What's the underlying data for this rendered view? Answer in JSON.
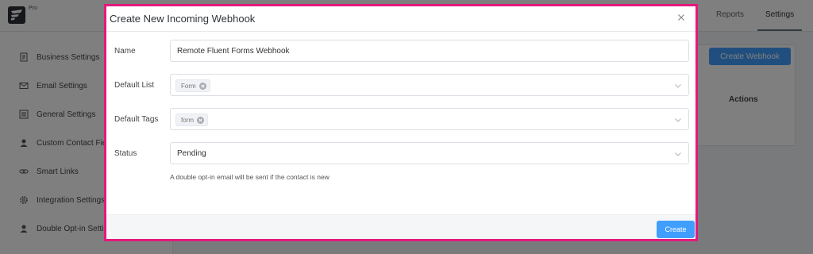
{
  "app": {
    "badge": "Pro",
    "tabs": [
      "Reports",
      "Settings"
    ]
  },
  "sidebar": {
    "items": [
      {
        "label": "Business Settings",
        "icon": "document-icon"
      },
      {
        "label": "Email Settings",
        "icon": "envelope-icon"
      },
      {
        "label": "General Settings",
        "icon": "list-icon"
      },
      {
        "label": "Custom Contact Fie",
        "icon": "user-icon"
      },
      {
        "label": "Smart Links",
        "icon": "link-icon"
      },
      {
        "label": "Integration Settings",
        "icon": "gear-icon"
      },
      {
        "label": "Double Opt-in Setti",
        "icon": "user-icon"
      }
    ]
  },
  "page": {
    "create_webhook_label": "Create Webhook",
    "actions_header": "Actions"
  },
  "modal": {
    "title": "Create New Incoming Webhook",
    "fields": {
      "name": {
        "label": "Name",
        "value": "Remote Fluent Forms Webhook"
      },
      "default_list": {
        "label": "Default List",
        "tags": [
          "Form"
        ]
      },
      "default_tags": {
        "label": "Default Tags",
        "tags": [
          "form"
        ]
      },
      "status": {
        "label": "Status",
        "value": "Pending"
      }
    },
    "help_text": "A double opt-in email will be sent if the contact is new",
    "create_label": "Create"
  },
  "colors": {
    "accent": "#409eff",
    "highlight_border": "#e5197b"
  }
}
